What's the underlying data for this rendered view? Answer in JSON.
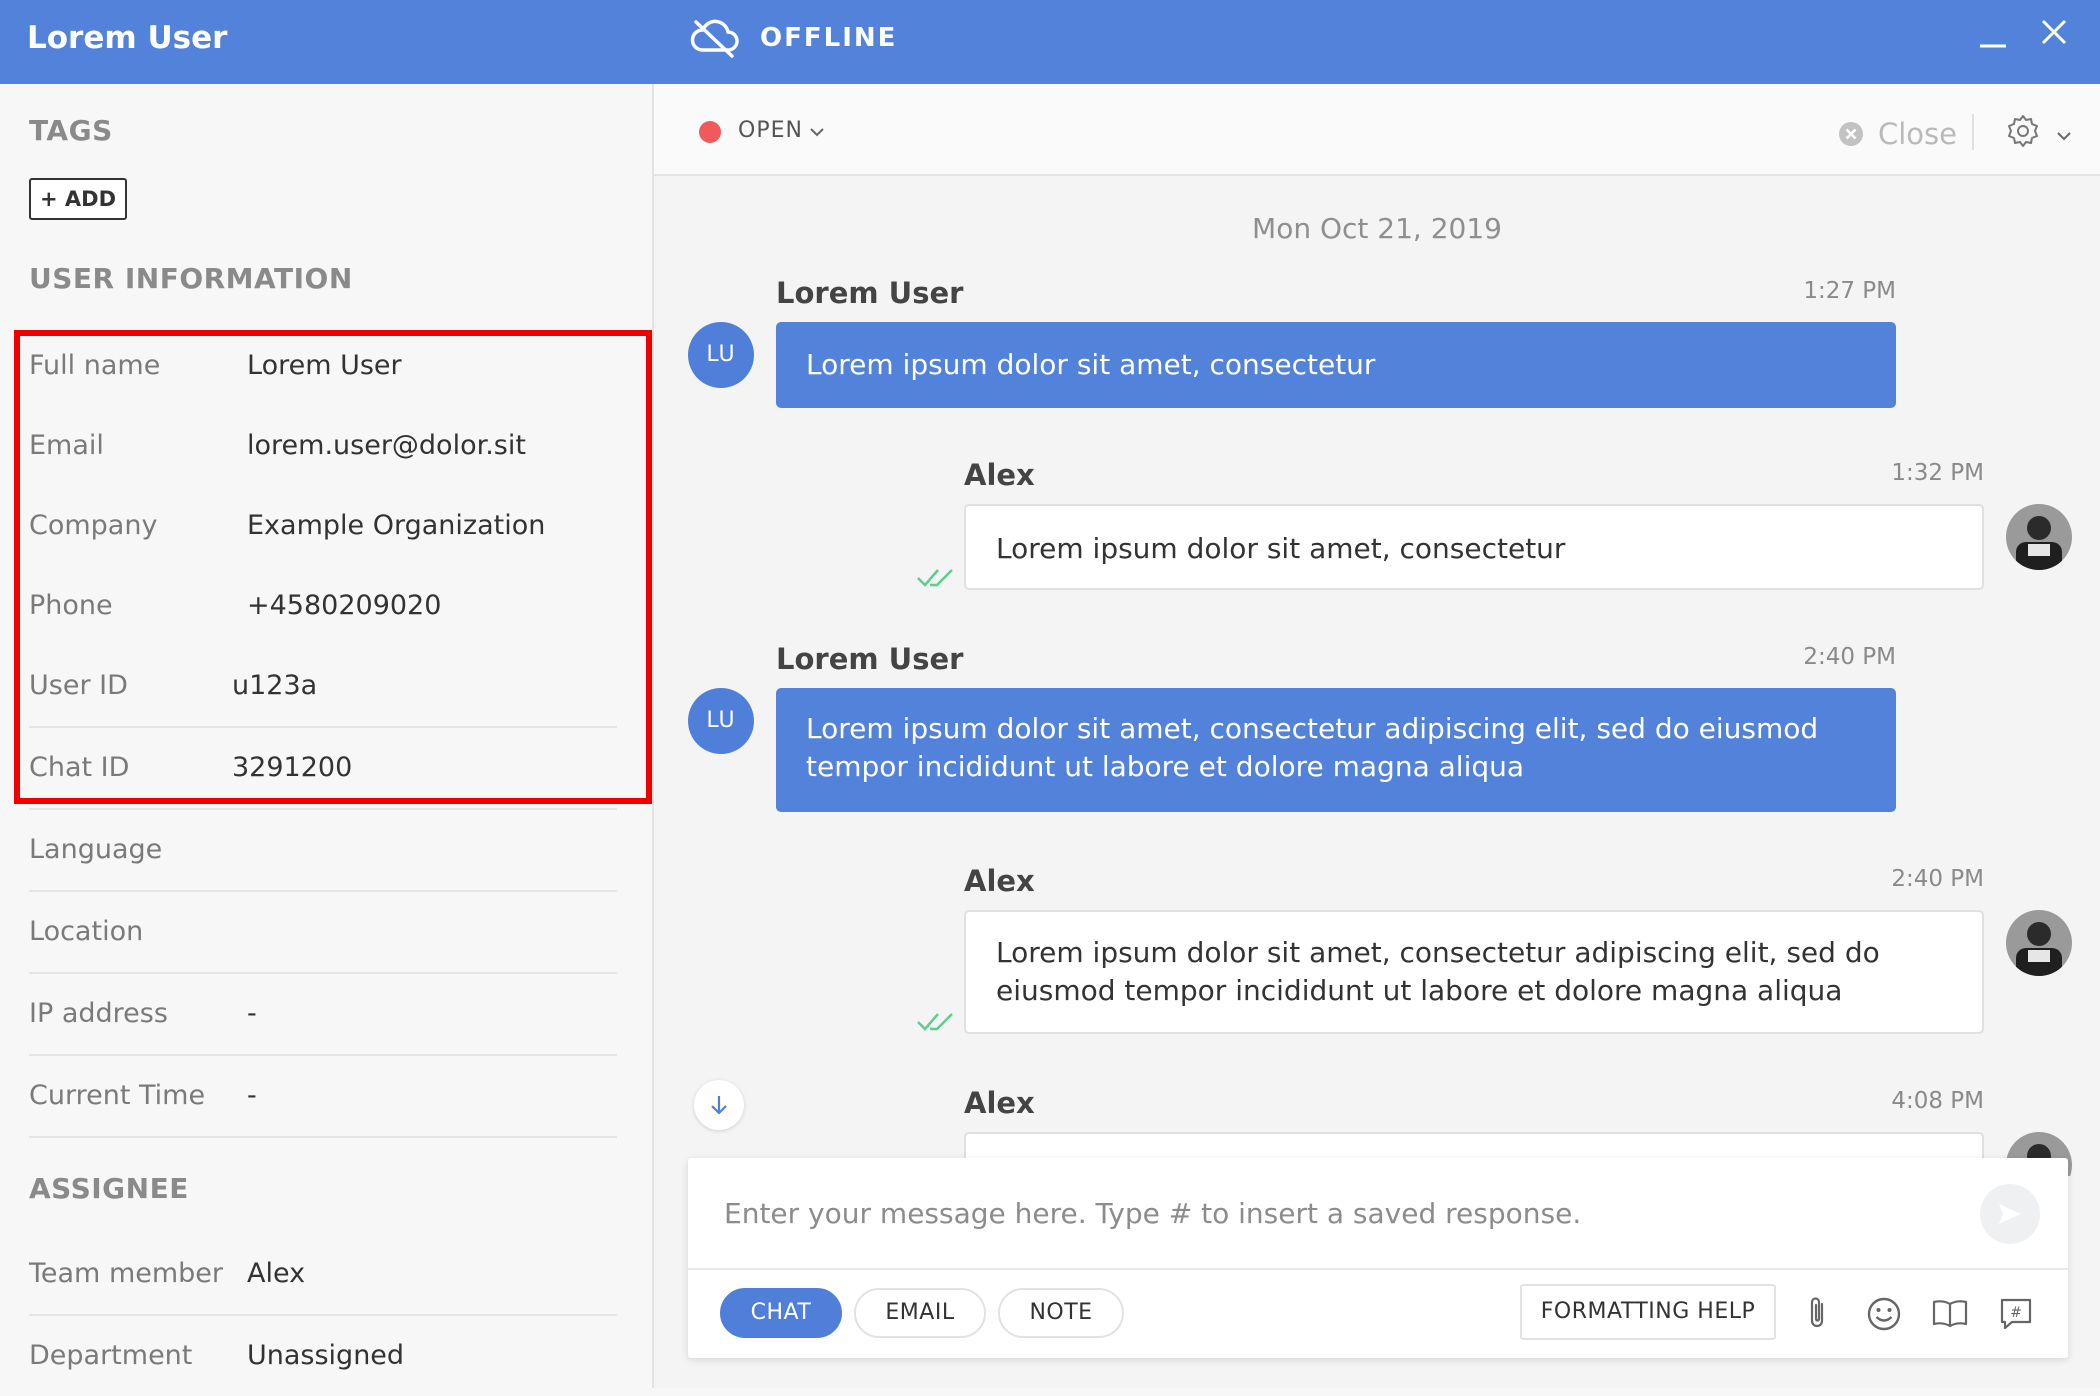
{
  "header": {
    "title": "Lorem User",
    "status": "OFFLINE",
    "status_icon": "cloud-offline-icon"
  },
  "left_panel": {
    "tags": {
      "heading": "TAGS",
      "add_label": "+ ADD"
    },
    "user_info": {
      "heading": "USER INFORMATION",
      "fields": [
        {
          "label": "Full name",
          "value": "Lorem User"
        },
        {
          "label": "Email",
          "value": "lorem.user@dolor.sit"
        },
        {
          "label": "Company",
          "value": "Example Organization"
        },
        {
          "label": "Phone",
          "value": "+4580209020"
        },
        {
          "label": "User ID",
          "value": "u123a"
        },
        {
          "label": "Chat ID",
          "value": "3291200"
        },
        {
          "label": "Language",
          "value": ""
        },
        {
          "label": "Location",
          "value": ""
        },
        {
          "label": "IP address",
          "value": "-"
        },
        {
          "label": "Current Time",
          "value": "-"
        }
      ]
    },
    "assignee": {
      "heading": "ASSIGNEE",
      "fields": [
        {
          "label": "Team member",
          "value": "Alex"
        },
        {
          "label": "Department",
          "value": "Unassigned"
        }
      ]
    }
  },
  "toolbar": {
    "status_label": "OPEN",
    "status_color": "#f05a5a",
    "close_label": "Close"
  },
  "chat": {
    "date": "Mon Oct 21, 2019",
    "messages": [
      {
        "sender": "Lorem User",
        "initials": "LU",
        "time": "1:27 PM",
        "text": "Lorem ipsum dolor sit amet, consectetur"
      },
      {
        "sender": "Alex",
        "time": "1:32 PM",
        "text": "Lorem ipsum dolor sit amet, consectetur"
      },
      {
        "sender": "Lorem User",
        "initials": "LU",
        "time": "2:40 PM",
        "text": "Lorem ipsum dolor sit amet, consectetur adipiscing elit, sed do eiusmod tempor incididunt ut labore et dolore magna aliqua"
      },
      {
        "sender": "Alex",
        "time": "2:40 PM",
        "text": "Lorem ipsum dolor sit amet, consectetur adipiscing elit, sed do eiusmod tempor incididunt ut labore et dolore magna aliqua"
      },
      {
        "sender": "Alex",
        "time": "4:08 PM",
        "text": ""
      }
    ]
  },
  "composer": {
    "placeholder": "Enter your message here. Type # to insert a saved response.",
    "modes": [
      "CHAT",
      "EMAIL",
      "NOTE"
    ],
    "active_mode": "CHAT",
    "formatting_help": "FORMATTING HELP"
  },
  "colors": {
    "brand": "#5282d9",
    "highlight": "#ee0000",
    "read_ticks": "#5ccf8a"
  }
}
